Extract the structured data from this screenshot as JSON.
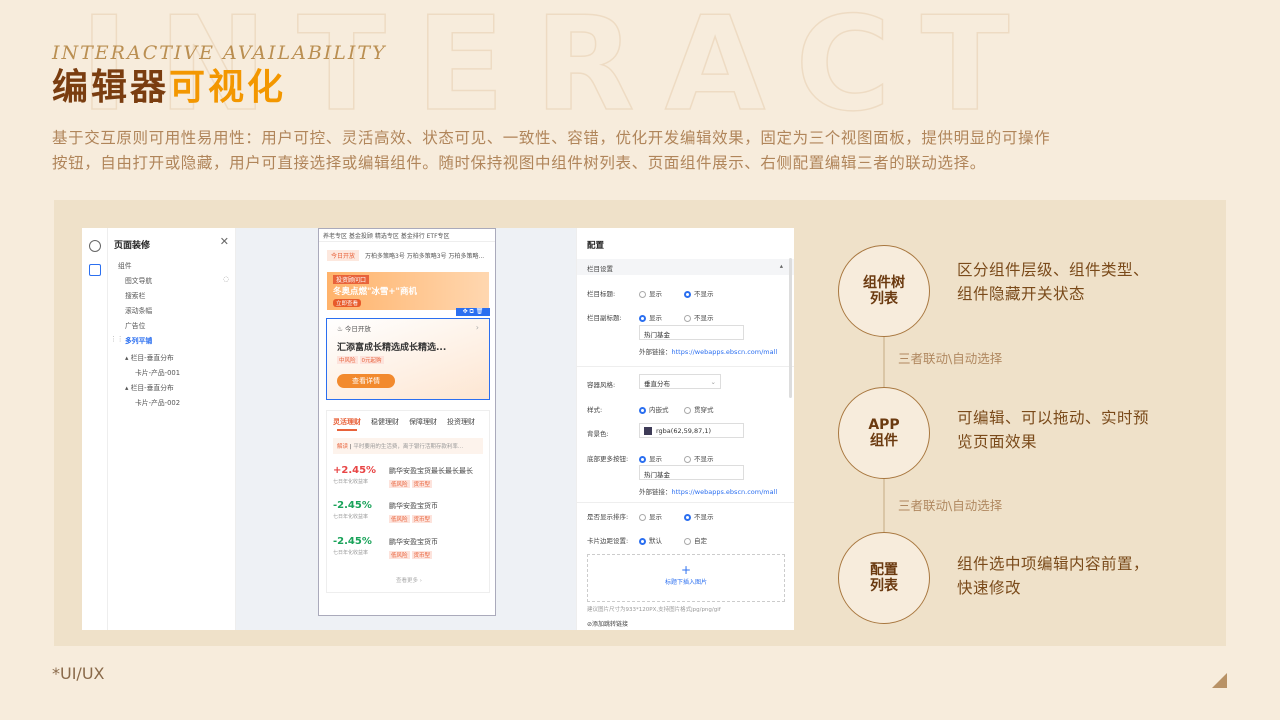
{
  "header": {
    "script": "INTERACTIVE AVAILABILITY",
    "title_a": "编辑器",
    "title_b": "可视化",
    "desc_line1": "基于交互原则可用性易用性：用户可控、灵活高效、状态可见、一致性、容错，优化开发编辑效果，固定为三个视图面板，提供明显的可操作",
    "desc_line2": "按钮，自由打开或隐藏，用户可直接选择或编辑组件。随时保持视图中组件树列表、页面组件展示、右侧配置编辑三者的联动选择。"
  },
  "editor": {
    "tree": {
      "title": "页面装修",
      "close": "✕",
      "items": [
        "组件",
        "图文导航",
        "搜索栏",
        "滚动条幅",
        "广告位",
        "多列平铺",
        "栏目-垂直分布",
        "卡片-产品-001",
        "栏目-垂直分布",
        "卡片-产品-002"
      ]
    },
    "phone": {
      "top_tabs": "养老专区  基金投顾  精选专区  基金排行  ETF专区",
      "ticker_tag": "今日开放",
      "ticker_text": "万柏多策略3号 万柏多策略3号 万柏多策略...",
      "banner_line1": "投资顾问口",
      "banner_line2": "冬奥点燃\"冰雪+\"商机",
      "banner_btn": "立即查看",
      "card_tag": "今日开放",
      "card_title": "汇添富成长精选成长精选...",
      "card_pills": [
        "中风险",
        "0元起购"
      ],
      "card_btn": "查看详情",
      "tabs": [
        "灵活理财",
        "稳健理财",
        "保障理财",
        "投资理财"
      ],
      "notice_tag": "解读",
      "notice_text": "平时要用的生活费，离于银行活期存款利率...",
      "products": [
        {
          "rate": "+2.45%",
          "label": "七日年化收益率",
          "name": "鹏华安盈宝货最长最长最长",
          "tags": [
            "低风险",
            "货币型"
          ]
        },
        {
          "rate": "-2.45%",
          "label": "七日年化收益率",
          "name": "鹏华安盈宝货币",
          "tags": [
            "低风险",
            "货币型"
          ]
        },
        {
          "rate": "-2.45%",
          "label": "七日年化收益率",
          "name": "鹏华安盈宝货币",
          "tags": [
            "低风险",
            "货币型"
          ]
        }
      ],
      "more": "查看更多 ›"
    },
    "config": {
      "title": "配置",
      "section": "栏目设置",
      "row1_label": "栏目标题:",
      "row1_opt1": "显示",
      "row1_opt2": "不显示",
      "row2_label": "栏目副标题:",
      "row2_opt1": "显示",
      "row2_opt2": "不显示",
      "input1": "热门基金",
      "link1_label": "外部链接：",
      "link1": "https://webapps.ebscn.com/mall",
      "style_label": "容器风格:",
      "style_value": "垂直分布",
      "pattern_label": "样式:",
      "pattern_opt1": "内嵌式",
      "pattern_opt2": "贯穿式",
      "bg_label": "背景色:",
      "bg_value": "rgba(62,59,87,1)",
      "more_label": "底部更多按钮:",
      "more_opt1": "显示",
      "more_opt2": "不显示",
      "input2": "热门基金",
      "link2_label": "外部链接：",
      "link2": "https://webapps.ebscn.com/mall",
      "sort_label": "是否显示排序:",
      "sort_opt1": "显示",
      "sort_opt2": "不显示",
      "margin_label": "卡片边距设置:",
      "margin_opt1": "默认",
      "margin_opt2": "自定",
      "upload_plus": "+",
      "upload_label": "标题下插入图片",
      "hint": "建议图片尺寸为933*120PX,支持图片格式jpg/png/gif",
      "add_link": "添加跳转链接"
    }
  },
  "features": [
    {
      "circle": "组件树\n列表",
      "text": "区分组件层级、组件类型、组件隐藏开关状态"
    },
    {
      "circle": "APP\n组件",
      "text": "可编辑、可以拖动、实时预览页面效果"
    },
    {
      "circle": "配置\n列表",
      "text": "组件选中项编辑内容前置，快速修改"
    }
  ],
  "connector": "三者联动\\自动选择",
  "footer": "*UI/UX",
  "colors": {
    "brown": "#7a3d10",
    "orange": "#f39700",
    "blue": "#2b6ff0"
  }
}
